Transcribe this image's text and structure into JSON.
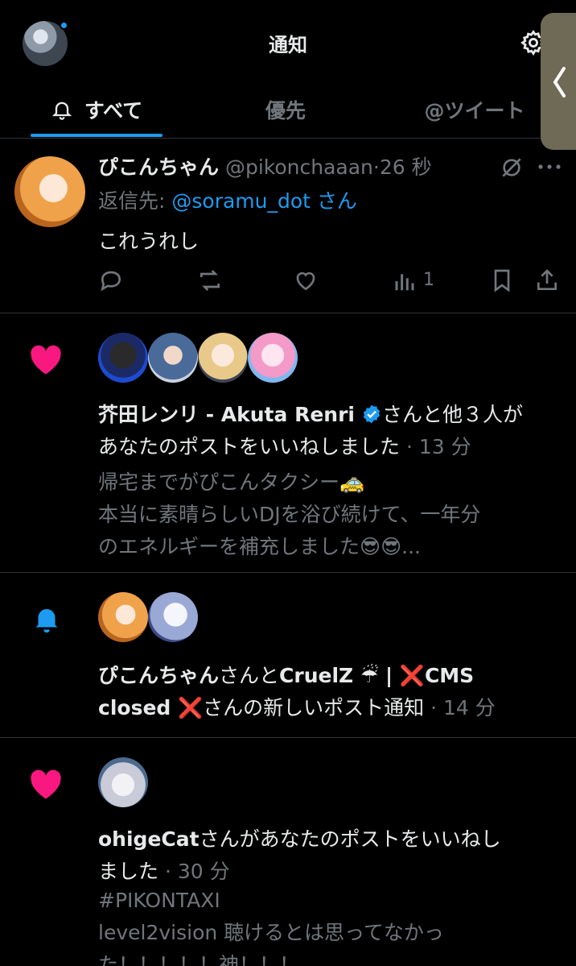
{
  "header": {
    "title": "通知",
    "tabs": [
      {
        "label": "すべて",
        "active": true
      },
      {
        "label": "優先",
        "active": false
      },
      {
        "label": "@ツイート",
        "active": false
      }
    ]
  },
  "tweet": {
    "name": "ぴこんちゃん",
    "handle": "@pikonchaaan",
    "time": "·26 秒",
    "reply_prefix": "返信先: ",
    "reply_to": "@soramu_dot",
    "reply_suffix": " さん",
    "body": "これうれし",
    "views": "1"
  },
  "notifications": [
    {
      "type": "like",
      "icon": "heart-icon",
      "actor": "芥田レンリ - Akuta Renri",
      "verified": true,
      "line1_rest": "さんと他３人が",
      "line2": "あなたのポストをいいねしました",
      "time": " · 13 分",
      "preview": [
        "帰宅までがぴこんタクシー🚕",
        "本当に素晴らしいDJを浴び続けて、一年分",
        "のエネルギーを補充しました😎😎..."
      ]
    },
    {
      "type": "new-post",
      "icon": "bell-icon",
      "actor1": "ぴこんちゃん",
      "joiner": "さんと",
      "actor2_a": "CruelZ ☔ | ❌CMS",
      "actor2_b": "closed ❌",
      "rest": "さんの新しいポスト通知",
      "time": " · 14 分"
    },
    {
      "type": "like",
      "icon": "heart-icon",
      "actor": "ohigeCat",
      "line1_rest": "さんがあなたのポストをいいねし",
      "line2": "ました",
      "time": " · 30 分",
      "preview": [
        "#PIKONTAXI",
        "level2vision 聴けるとは思ってなかっ",
        "た！！！！！神！！！"
      ]
    }
  ],
  "colors": {
    "accent": "#1d9bf0",
    "like": "#f91880",
    "muted": "#71767b",
    "divider": "#2f3336"
  }
}
